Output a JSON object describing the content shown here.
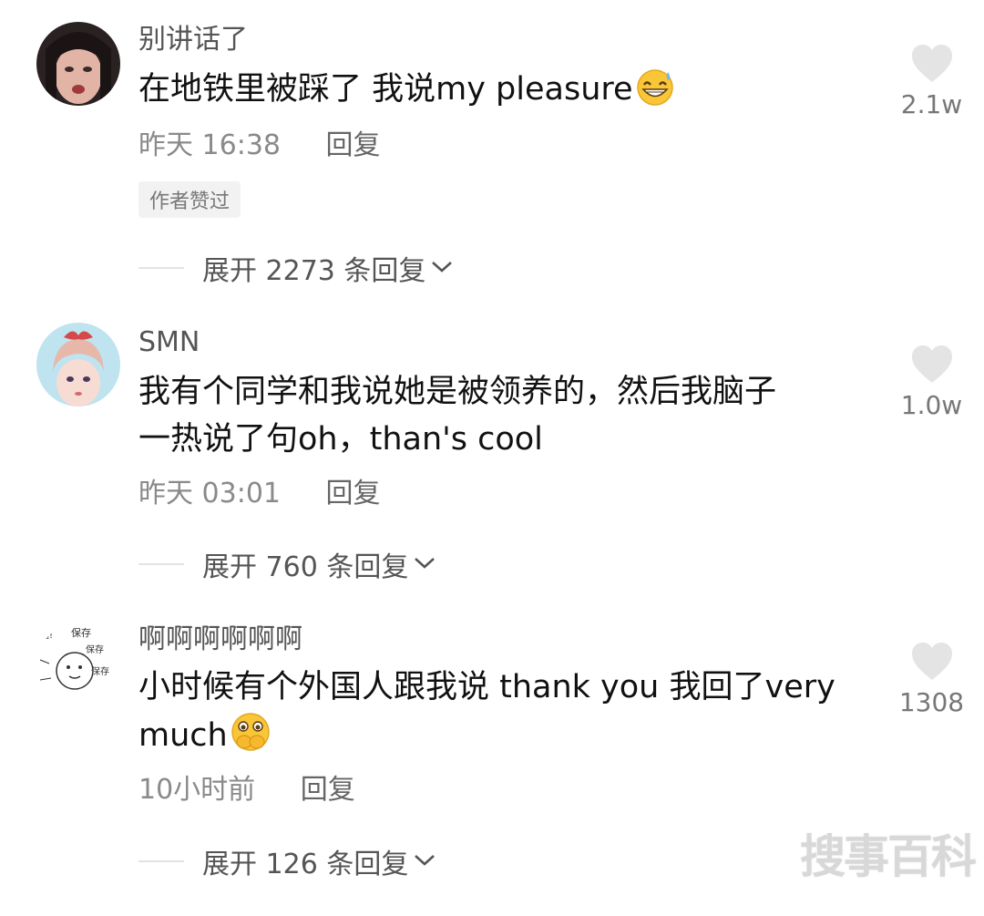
{
  "comments": [
    {
      "username": "别讲话了",
      "text": "在地铁里被踩了 我说my pleasure",
      "emoji": "sweat-grin-emoji",
      "time": "昨天 16:38",
      "reply": "回复",
      "badge": "作者赞过",
      "expand": "展开 2273 条回复",
      "likes": "2.1w"
    },
    {
      "username": "SMN",
      "text_line1": "我有个同学和我说她是被领养的，然后我脑子",
      "text_line2": "一热说了句oh，than's cool",
      "time": "昨天 03:01",
      "reply": "回复",
      "expand": "展开 760 条回复",
      "likes": "1.0w"
    },
    {
      "username": "啊啊啊啊啊啊",
      "text_line1": "小时候有个外国人跟我说 thank you 我回了very",
      "text_line2": "much",
      "emoji": "hands-over-mouth-emoji",
      "avatar_labels": [
        "遍!",
        "保存",
        "保存",
        "保存"
      ],
      "time": "10小时前",
      "reply": "回复",
      "expand": "展开 126 条回复",
      "likes": "1308"
    }
  ],
  "watermark": "搜事百科",
  "colors": {
    "text": "#111111",
    "secondary": "#8a8a8a",
    "heart": "#e4e4e4",
    "badge_bg": "#f2f2f2"
  }
}
